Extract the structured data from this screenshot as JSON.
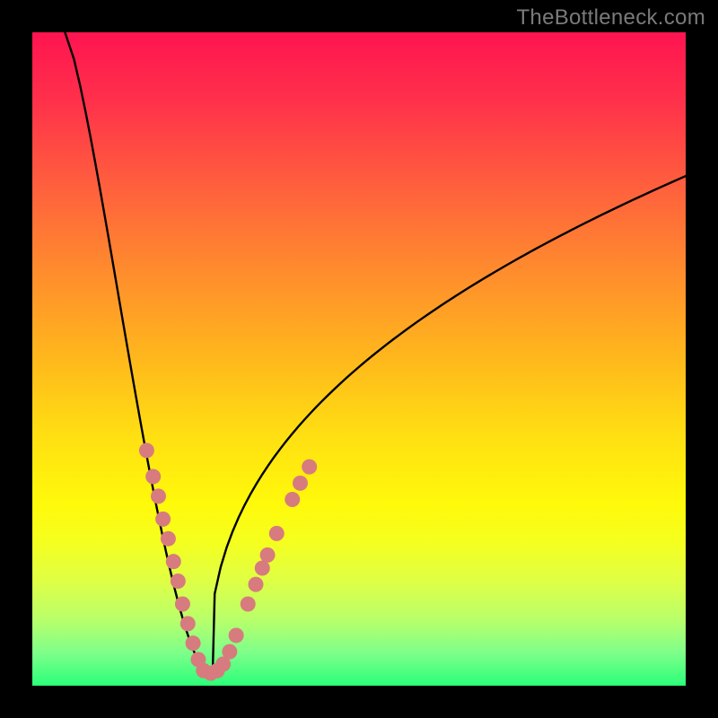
{
  "watermark": "TheBottleneck.com",
  "chart_data": {
    "type": "line",
    "title": "",
    "xlabel": "",
    "ylabel": "",
    "xlim": [
      0,
      100
    ],
    "ylim": [
      0,
      100
    ],
    "curve": {
      "description": "V-shaped bottleneck curve with minimum near x≈27; left branch falls steeply from top-left, right branch rises with decreasing slope toward upper right",
      "minimum_x": 27,
      "minimum_y": 2,
      "left_start": {
        "x": 5,
        "y": 100
      },
      "right_end": {
        "x": 100,
        "y": 78
      }
    },
    "marker_series": [
      {
        "name": "left-branch-markers",
        "color": "#d77b7f",
        "points": [
          {
            "x": 17.5,
            "y": 36
          },
          {
            "x": 18.5,
            "y": 32
          },
          {
            "x": 19.3,
            "y": 29
          },
          {
            "x": 20.0,
            "y": 25.5
          },
          {
            "x": 20.8,
            "y": 22.5
          },
          {
            "x": 21.6,
            "y": 19
          },
          {
            "x": 22.3,
            "y": 16
          },
          {
            "x": 23.0,
            "y": 12.5
          },
          {
            "x": 23.8,
            "y": 9.5
          },
          {
            "x": 24.6,
            "y": 6.5
          },
          {
            "x": 25.4,
            "y": 4
          }
        ]
      },
      {
        "name": "bottom-markers",
        "color": "#d77b7f",
        "points": [
          {
            "x": 26.2,
            "y": 2.3
          },
          {
            "x": 27.3,
            "y": 1.9
          },
          {
            "x": 28.3,
            "y": 2.3
          },
          {
            "x": 29.2,
            "y": 3.3
          }
        ]
      },
      {
        "name": "right-branch-markers",
        "color": "#d77b7f",
        "points": [
          {
            "x": 30.2,
            "y": 5.2
          },
          {
            "x": 31.2,
            "y": 7.7
          },
          {
            "x": 33.0,
            "y": 12.5
          },
          {
            "x": 34.2,
            "y": 15.5
          },
          {
            "x": 35.2,
            "y": 18
          },
          {
            "x": 36.0,
            "y": 20
          },
          {
            "x": 37.4,
            "y": 23.3
          },
          {
            "x": 39.8,
            "y": 28.5
          },
          {
            "x": 41.0,
            "y": 31
          },
          {
            "x": 42.4,
            "y": 33.5
          }
        ]
      }
    ]
  }
}
